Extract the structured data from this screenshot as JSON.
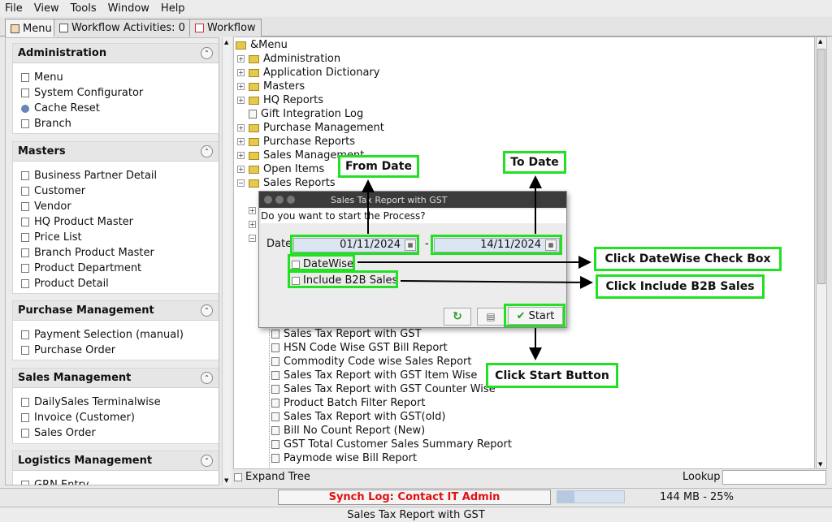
{
  "menubar": [
    "File",
    "View",
    "Tools",
    "Window",
    "Help"
  ],
  "tabs": [
    {
      "label": "Menu"
    },
    {
      "label": "Workflow Activities: 0"
    },
    {
      "label": "Workflow"
    }
  ],
  "sidebar": {
    "panels": [
      {
        "title": "Administration",
        "items": [
          {
            "label": "Menu",
            "icon": "doc-icon"
          },
          {
            "label": "System Configurator",
            "icon": "doc-icon"
          },
          {
            "label": "Cache Reset",
            "icon": "gear-icon"
          },
          {
            "label": "Branch",
            "icon": "doc-icon"
          }
        ]
      },
      {
        "title": "Masters",
        "items": [
          {
            "label": "Business Partner Detail"
          },
          {
            "label": "Customer"
          },
          {
            "label": "Vendor"
          },
          {
            "label": "HQ Product Master"
          },
          {
            "label": "Price List"
          },
          {
            "label": "Branch Product Master"
          },
          {
            "label": "Product Department"
          },
          {
            "label": "Product Detail"
          }
        ]
      },
      {
        "title": "Purchase Management",
        "items": [
          {
            "label": "Payment Selection (manual)"
          },
          {
            "label": "Purchase Order"
          }
        ]
      },
      {
        "title": "Sales Management",
        "items": [
          {
            "label": "DailySales Terminalwise"
          },
          {
            "label": "Invoice (Customer)"
          },
          {
            "label": "Sales Order"
          }
        ]
      },
      {
        "title": "Logistics Management",
        "items": [
          {
            "label": "GRN Entry"
          }
        ]
      }
    ]
  },
  "tree": {
    "root": "&Menu",
    "folders": [
      "Administration",
      "Application Dictionary",
      "Masters",
      "HQ Reports",
      "Gift Integration Log",
      "Purchase Management",
      "Purchase Reports",
      "Sales Management",
      "Open Items",
      "Sales Reports"
    ],
    "reports": [
      "Sales Tax Report with GST",
      "HSN Code Wise GST Bill Report",
      "Commodity Code wise Sales Report",
      "Sales Tax Report with GST Item Wise",
      "Sales Tax Report with GST Counter Wise",
      "Product Batch Filter Report",
      "Sales Tax Report with GST(old)",
      "Bill No Count Report (New)",
      "GST Total Customer Sales Summary Report",
      "Paymode wise Bill Report"
    ]
  },
  "bottom": {
    "expand_tree": "Expand Tree",
    "lookup": "Lookup",
    "synch_log": "Synch Log: Contact IT Admin",
    "memory": "144 MB - 25%",
    "memory_fraction": 0.25,
    "footer": "Sales Tax Report with GST"
  },
  "dialog": {
    "title": "Sales Tax Report with GST",
    "question": "Do you want to start the Process?",
    "date_label": "Date",
    "date_from": "01/11/2024",
    "date_sep": "-",
    "date_to": "14/11/2024",
    "datewise_label": "DateWise",
    "b2b_label": "Include B2B Sales",
    "start_label": "Start"
  },
  "annotations": {
    "from_date": "From Date",
    "to_date": "To Date",
    "datewise": "Click DateWise Check Box",
    "b2b": "Click Include B2B Sales",
    "start": "Click Start Button"
  },
  "colors": {
    "highlight": "#22e022",
    "synch_text": "#e01010"
  }
}
